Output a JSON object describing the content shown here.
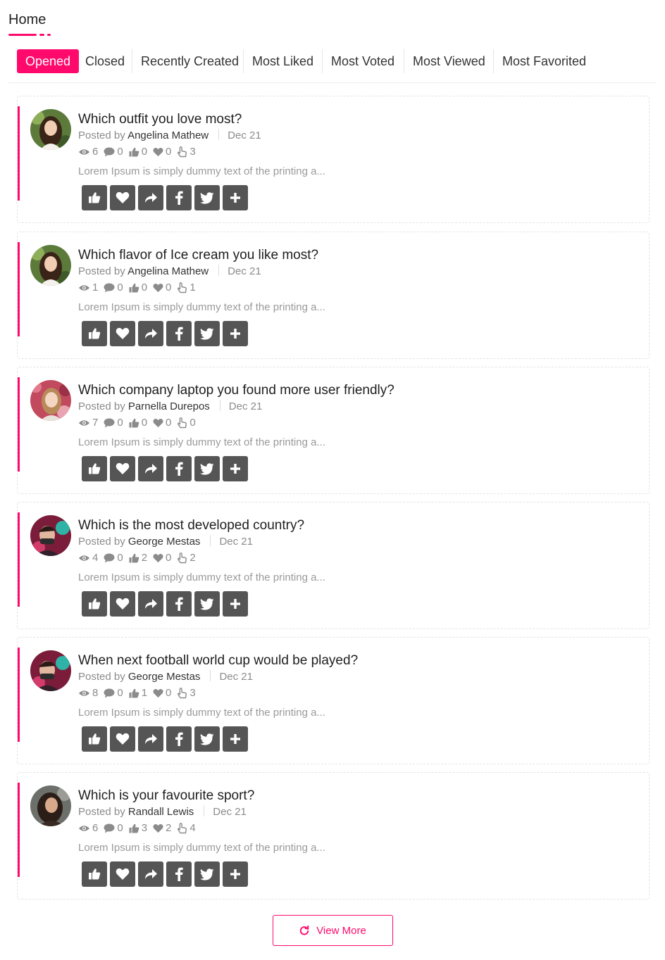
{
  "page": {
    "title": "Home",
    "accent_color": "#ff0a6c"
  },
  "tabs": [
    {
      "label": "Opened",
      "active": true
    },
    {
      "label": "Closed"
    },
    {
      "label": "Recently Created"
    },
    {
      "label": "Most Liked"
    },
    {
      "label": "Most Voted"
    },
    {
      "label": "Most Viewed"
    },
    {
      "label": "Most Favorited"
    }
  ],
  "posted_by_label": "Posted by",
  "questions": [
    {
      "title": "Which outfit you love most?",
      "author": "Angelina Mathew",
      "date": "Dec 21",
      "views": "6",
      "comments": "0",
      "likes": "0",
      "favorites": "0",
      "votes": "3",
      "excerpt": "Lorem Ipsum is simply dummy text of the printing a..."
    },
    {
      "title": "Which flavor of Ice cream you like most?",
      "author": "Angelina Mathew",
      "date": "Dec 21",
      "views": "1",
      "comments": "0",
      "likes": "0",
      "favorites": "0",
      "votes": "1",
      "excerpt": "Lorem Ipsum is simply dummy text of the printing a..."
    },
    {
      "title": "Which company laptop you found more user friendly?",
      "author": "Parnella Durepos",
      "date": "Dec 21",
      "views": "7",
      "comments": "0",
      "likes": "0",
      "favorites": "0",
      "votes": "0",
      "excerpt": "Lorem Ipsum is simply dummy text of the printing a..."
    },
    {
      "title": "Which is the most developed country?",
      "author": "George Mestas",
      "date": "Dec 21",
      "views": "4",
      "comments": "0",
      "likes": "2",
      "favorites": "0",
      "votes": "2",
      "excerpt": "Lorem Ipsum is simply dummy text of the printing a..."
    },
    {
      "title": "When next football world cup would be played?",
      "author": "George Mestas",
      "date": "Dec 21",
      "views": "8",
      "comments": "0",
      "likes": "1",
      "favorites": "0",
      "votes": "3",
      "excerpt": "Lorem Ipsum is simply dummy text of the printing a..."
    },
    {
      "title": "Which is your favourite sport?",
      "author": "Randall Lewis",
      "date": "Dec 21",
      "views": "6",
      "comments": "0",
      "likes": "3",
      "favorites": "2",
      "votes": "4",
      "excerpt": "Lorem Ipsum is simply dummy text of the printing a..."
    }
  ],
  "actions": [
    "thumbs-up-icon",
    "heart-icon",
    "share-icon",
    "facebook-icon",
    "twitter-icon",
    "plus-icon"
  ],
  "view_more": {
    "label": "View More",
    "icon": "refresh-icon"
  }
}
